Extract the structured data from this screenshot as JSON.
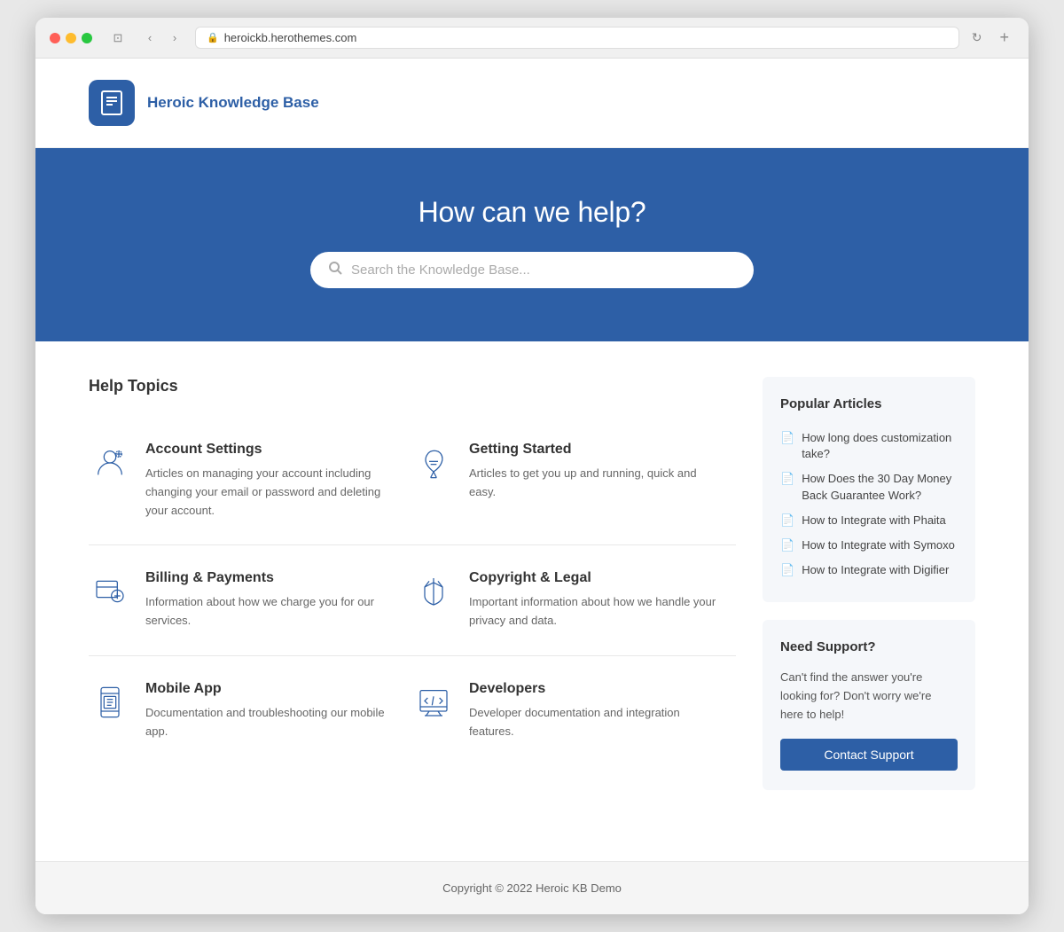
{
  "browser": {
    "url": "heroickb.herothemes.com",
    "url_icon": "🔒"
  },
  "header": {
    "logo_text": "Heroic Knowledge Base"
  },
  "hero": {
    "title": "How can we help?",
    "search_placeholder": "Search the Knowledge Base..."
  },
  "main": {
    "section_title": "Help Topics",
    "topics": [
      {
        "id": "account-settings",
        "title": "Account Settings",
        "description": "Articles on managing your account including changing your email or password and deleting your account.",
        "icon_type": "user-settings"
      },
      {
        "id": "getting-started",
        "title": "Getting Started",
        "description": "Articles to get you up and running, quick and easy.",
        "icon_type": "rocket"
      },
      {
        "id": "billing-payments",
        "title": "Billing & Payments",
        "description": "Information about how we charge you for our services.",
        "icon_type": "billing"
      },
      {
        "id": "copyright-legal",
        "title": "Copyright & Legal",
        "description": "Important information about how we handle your privacy and data.",
        "icon_type": "legal"
      },
      {
        "id": "mobile-app",
        "title": "Mobile App",
        "description": "Documentation and troubleshooting our mobile app.",
        "icon_type": "mobile"
      },
      {
        "id": "developers",
        "title": "Developers",
        "description": "Developer documentation and integration features.",
        "icon_type": "developers"
      }
    ]
  },
  "sidebar": {
    "popular_articles": {
      "title": "Popular Articles",
      "articles": [
        {
          "id": 1,
          "text": "How long does customization take?"
        },
        {
          "id": 2,
          "text": "How Does the 30 Day Money Back Guarantee Work?"
        },
        {
          "id": 3,
          "text": "How to Integrate with Phaita"
        },
        {
          "id": 4,
          "text": "How to Integrate with Symoxo"
        },
        {
          "id": 5,
          "text": "How to Integrate with Digifier"
        }
      ]
    },
    "support": {
      "title": "Need Support?",
      "description": "Can't find the answer you're looking for? Don't worry we're here to help!",
      "button_label": "Contact Support"
    }
  },
  "footer": {
    "text": "Copyright © 2022 Heroic KB Demo"
  }
}
